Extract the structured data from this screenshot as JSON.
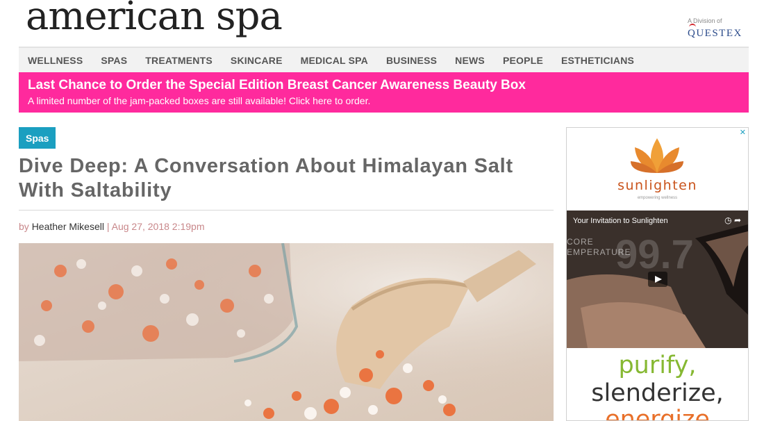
{
  "header": {
    "logo": "american spa",
    "division_label": "A Division of",
    "parent_brand": "QUESTEX"
  },
  "nav": {
    "items": [
      "WELLNESS",
      "SPAS",
      "TREATMENTS",
      "SKINCARE",
      "MEDICAL SPA",
      "BUSINESS",
      "NEWS",
      "PEOPLE",
      "ESTHETICIANS"
    ]
  },
  "promo": {
    "title": "Last Chance to Order the Special Edition Breast Cancer Awareness Beauty Box",
    "subtitle": "A limited number of the jam-packed boxes are still available! Click here to order.",
    "background": "#ff2a9d"
  },
  "article": {
    "category": "Spas",
    "headline": "Dive Deep: A Conversation About Himalayan Salt With Saltability",
    "by": "by",
    "author": "Heather Mikesell",
    "separator": "|",
    "date": "Aug 27, 2018 2:19pm"
  },
  "ad": {
    "close": "✕",
    "brand": "sunlighten",
    "tagline": "empowering wellness",
    "video_title": "Your Invitation to Sunlighten",
    "video_controls": "◷ ➦",
    "overlay_text_1": "CORE",
    "overlay_text_2": "EMPERATURE",
    "overlay_number": "99.7",
    "line1": "purify,",
    "line2": "slenderize,",
    "line3": "energize"
  },
  "colors": {
    "accent_blue": "#1b9fc0",
    "promo_pink": "#ff2a9d",
    "byline": "#c8878a"
  }
}
